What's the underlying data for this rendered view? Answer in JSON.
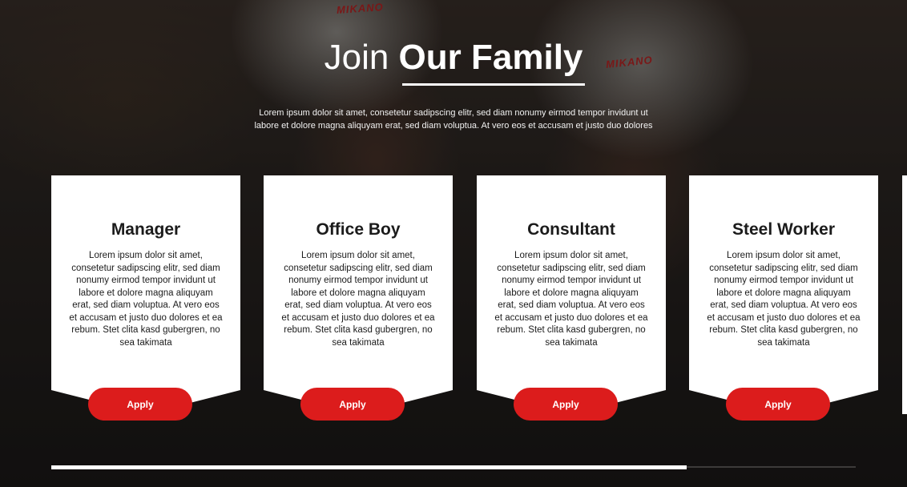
{
  "background": {
    "hat_logo_left": "MIKANO",
    "hat_logo_right": "MIKANO"
  },
  "header": {
    "title_light": "Join",
    "title_bold": "Our Family",
    "intro_line1": "Lorem ipsum dolor sit amet, consetetur sadipscing elitr, sed diam nonumy eirmod tempor invidunt ut",
    "intro_line2": "labore et dolore magna aliquyam erat, sed diam voluptua. At vero eos et accusam et justo duo dolores"
  },
  "cards": [
    {
      "title": "Manager",
      "description": "Lorem ipsum dolor sit amet, consetetur sadipscing elitr, sed diam nonumy eirmod tempor invidunt ut labore et dolore magna aliquyam erat, sed diam voluptua. At vero eos et accusam et justo duo dolores et ea rebum. Stet clita kasd gubergren, no sea takimata",
      "button_label": "Apply"
    },
    {
      "title": "Office Boy",
      "description": "Lorem ipsum dolor sit amet, consetetur sadipscing elitr, sed diam nonumy eirmod tempor invidunt ut labore et dolore magna aliquyam erat, sed diam voluptua. At vero eos et accusam et justo duo dolores et ea rebum. Stet clita kasd gubergren, no sea takimata",
      "button_label": "Apply"
    },
    {
      "title": "Consultant",
      "description": "Lorem ipsum dolor sit amet, consetetur sadipscing elitr, sed diam nonumy eirmod tempor invidunt ut labore et dolore magna aliquyam erat, sed diam voluptua. At vero eos et accusam et justo duo dolores et ea rebum. Stet clita kasd gubergren, no sea takimata",
      "button_label": "Apply"
    },
    {
      "title": "Steel Worker",
      "description": "Lorem ipsum dolor sit amet, consetetur sadipscing elitr, sed diam nonumy eirmod tempor invidunt ut labore et dolore magna aliquyam erat, sed diam voluptua. At vero eos et accusam et justo duo dolores et ea rebum. Stet clita kasd gubergren, no sea takimata",
      "button_label": "Apply"
    }
  ],
  "carousel": {
    "progress_fraction": 0.79
  },
  "colors": {
    "accent": "#dc1c1c",
    "card": "#ffffff",
    "text": "#1b1b1b"
  }
}
